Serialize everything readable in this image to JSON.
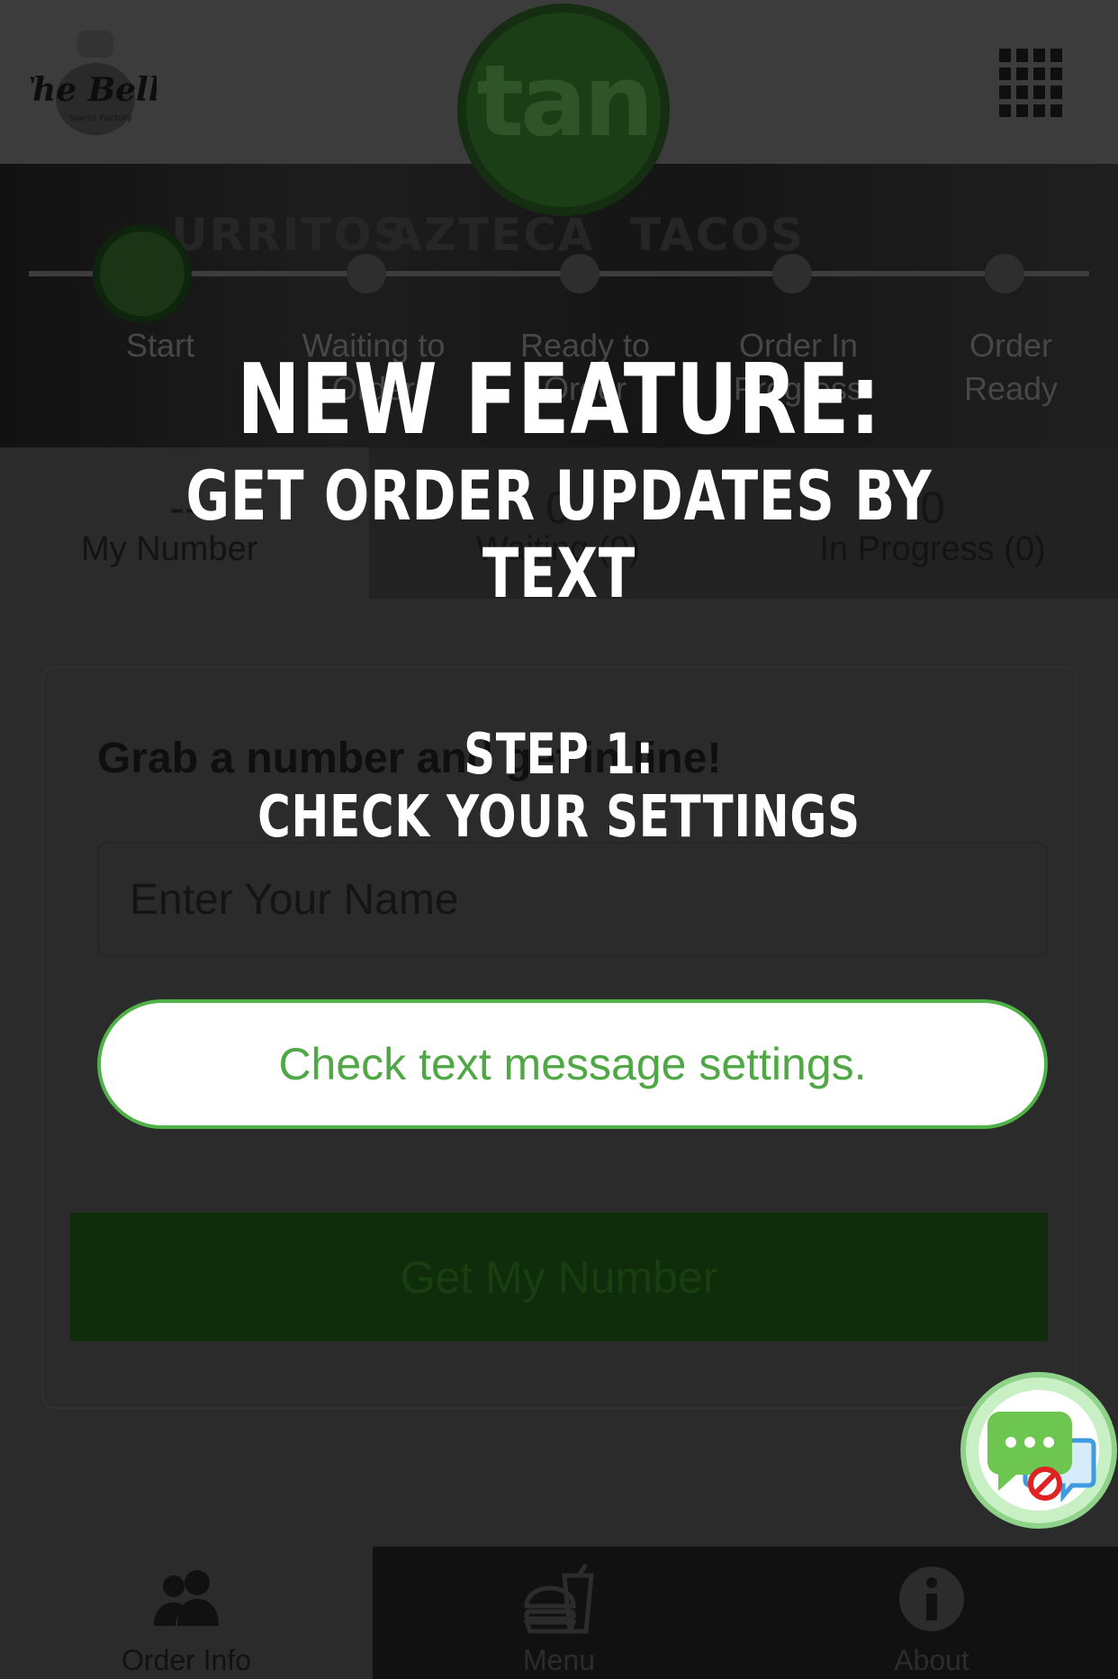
{
  "header": {
    "brand_logo_text": "The Bells",
    "brand_logo_subtext": "Sweet Factory",
    "app_logo_text": "tan",
    "menu_icon": "grid-icon"
  },
  "hero": {
    "background_words": [
      "URRITOS",
      "AZTECA",
      "TACOS"
    ],
    "progress_steps": [
      "Start",
      "Waiting to Order",
      "Ready to Order",
      "Order In Progress",
      "Order Ready"
    ],
    "active_step": 0
  },
  "tabs": {
    "my_number": {
      "count": "--",
      "label": "My Number"
    },
    "waiting": {
      "count": "0",
      "label": "Waiting (0)"
    },
    "in_progress": {
      "count": "0",
      "label": "In Progress (0)"
    }
  },
  "form": {
    "title": "Grab a number and get in line!",
    "name_placeholder": "Enter Your Name",
    "submit_label": "Get My Number"
  },
  "overlay": {
    "headline": "NEW FEATURE:",
    "subheadline": "GET ORDER UPDATES BY TEXT",
    "step_title": "STEP 1:",
    "step_text": "CHECK YOUR SETTINGS",
    "action_label": "Check text message settings."
  },
  "bottom_nav": [
    {
      "label": "Order Info",
      "icon": "users-icon"
    },
    {
      "label": "Menu",
      "icon": "burger-drink-icon"
    },
    {
      "label": "About",
      "icon": "info-icon"
    }
  ],
  "chat_button": {
    "icon": "sms-disabled-icon"
  },
  "colors": {
    "accent_green": "#4fb246",
    "dim_green": "#0f2d0a",
    "logo_green": "#1c3e16",
    "overlay_text": "#ffffff"
  }
}
